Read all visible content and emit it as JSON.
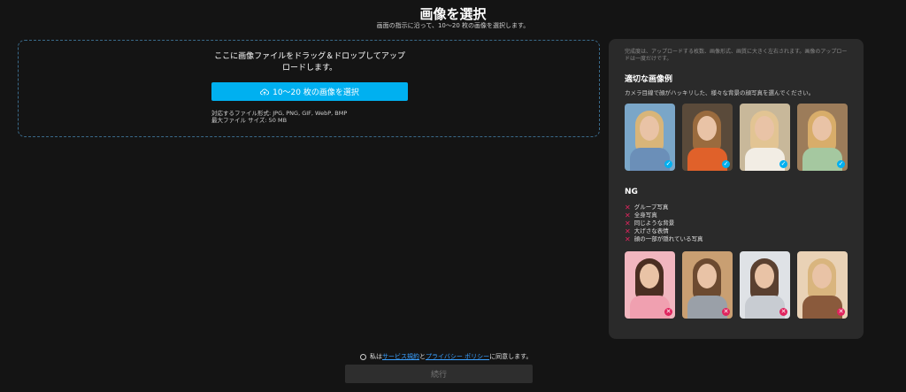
{
  "header": {
    "title": "画像を選択",
    "subtitle": "画面の指示に沿って、10～20 枚の画像を選択します。"
  },
  "dropzone": {
    "instruction": "ここに画像ファイルをドラッグ＆ドロップしてアップロードします。",
    "button_label": "10～20 枚の画像を選択",
    "formats": "対応するファイル形式: JPG, PNG, GIF, WebP, BMP",
    "max_size": "最大ファイル サイズ: 50 MB"
  },
  "panel": {
    "note": "完成度は、アップロードする枚数、画像形式、画質に大きく左右されます。画像のアップロードは一度だけです。",
    "good_title": "適切な画像例",
    "good_desc": "カメラ目線で顔がハッキリした、様々な背景の顔写真を選んでください。",
    "good_photos": [
      {
        "hair": "#d8b579",
        "body": "#6b8fb8",
        "bg": "#7aa6c8"
      },
      {
        "hair": "#9a6b3e",
        "body": "#e0612a",
        "bg": "#5a4a3a"
      },
      {
        "hair": "#e2c493",
        "body": "#f2ede4",
        "bg": "#c8b89a"
      },
      {
        "hair": "#d8ad6a",
        "body": "#a5c8a0",
        "bg": "#9c7c5a"
      }
    ],
    "ng_title": "NG",
    "ng_items": [
      "グループ写真",
      "全身写真",
      "同じような背景",
      "大げさな表情",
      "顔の一部が隠れている写真"
    ],
    "bad_photos": [
      {
        "hair": "#4a2e22",
        "body": "#f0a0b0",
        "bg": "#f1b6bf"
      },
      {
        "hair": "#6c4a30",
        "body": "#9aa0a8",
        "bg": "#c99f72"
      },
      {
        "hair": "#5a4030",
        "body": "#c8ccd2",
        "bg": "#dfe2e6"
      },
      {
        "hair": "#d9b57e",
        "body": "#8a5a3c",
        "bg": "#e9d2b6"
      }
    ]
  },
  "footer": {
    "agree_prefix": "私は",
    "terms_link": "サービス規約",
    "and": "と",
    "privacy_link": "プライバシー ポリシー",
    "agree_suffix": "に同意します。",
    "continue_label": "続行"
  }
}
